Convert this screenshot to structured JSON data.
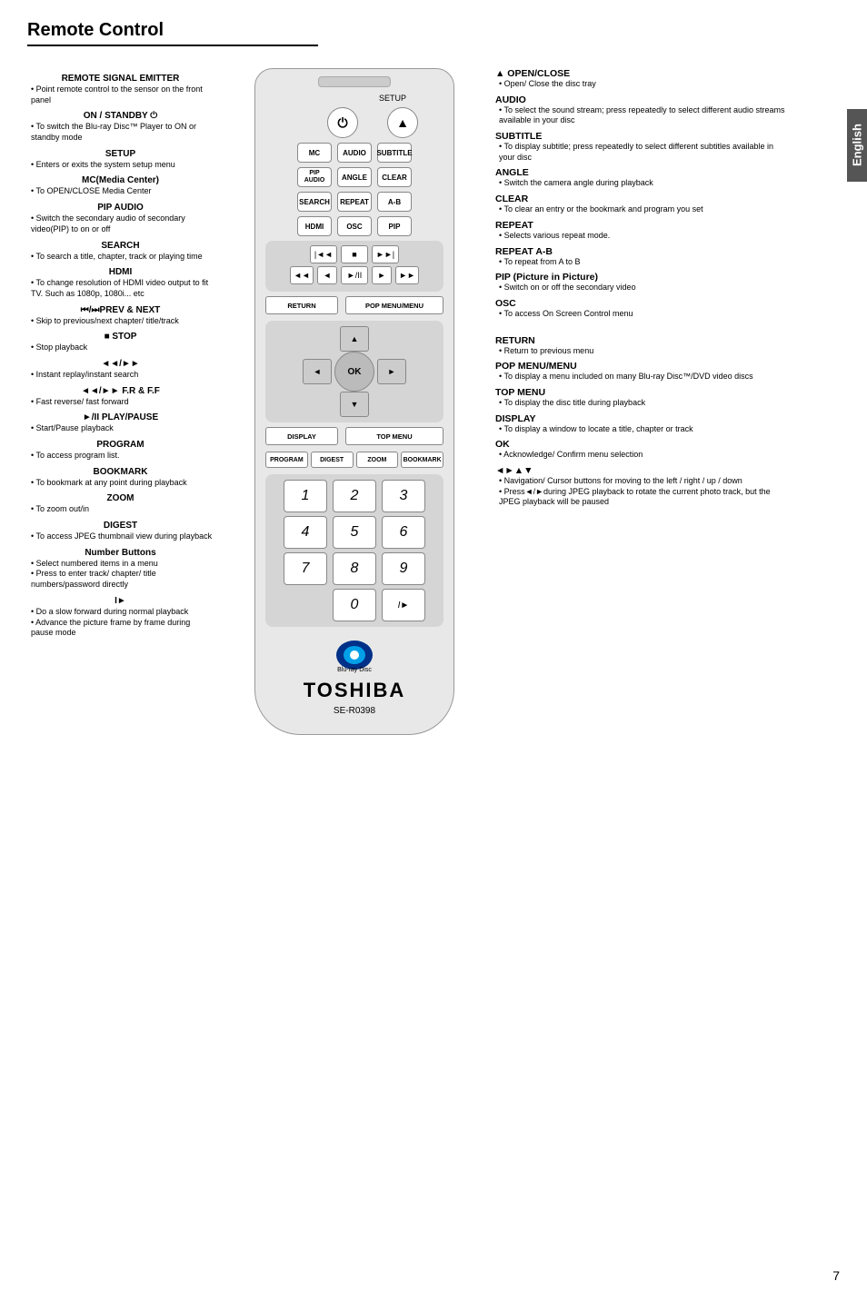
{
  "page": {
    "title": "Remote Control",
    "page_number": "7",
    "language_tab": "English"
  },
  "left_column": {
    "sections": [
      {
        "id": "remote-signal",
        "title": "REMOTE SIGNAL EMITTER",
        "bullets": [
          "Point remote control to the sensor on the front panel"
        ]
      },
      {
        "id": "on-standby",
        "title": "ON / STANDBY ⏻",
        "bullets": [
          "To switch the Blu-ray Disc™ Player to ON or standby mode"
        ]
      },
      {
        "id": "setup",
        "title": "SETUP",
        "bullets": [
          "Enters or exits the system setup menu"
        ]
      },
      {
        "id": "mc",
        "title": "MC(Media Center)",
        "bullets": [
          "To OPEN/CLOSE Media Center"
        ]
      },
      {
        "id": "pip-audio",
        "title": "PIP AUDIO",
        "bullets": [
          "Switch the secondary audio of secondary video(PIP) to on or off"
        ]
      },
      {
        "id": "search",
        "title": "SEARCH",
        "bullets": [
          "To search a title, chapter, track or playing time"
        ]
      },
      {
        "id": "hdmi",
        "title": "HDMI",
        "bullets": [
          "To change resolution of HDMI video output to fit TV. Such as 1080p, 1080i... etc"
        ]
      },
      {
        "id": "prev-next",
        "title": "⏮/⏭PREV & NEXT",
        "bullets": [
          "Skip to previous/next chapter/ title/track"
        ]
      },
      {
        "id": "stop",
        "title": "■ STOP",
        "bullets": [
          "Stop playback"
        ]
      },
      {
        "id": "instant",
        "title": "◄◄/►► ",
        "bullets": [
          "Instant replay/instant search"
        ]
      },
      {
        "id": "frf",
        "title": "◄◄/►► F.R & F.F",
        "bullets": [
          "Fast reverse/ fast forward"
        ]
      },
      {
        "id": "playpause",
        "title": "►/II PLAY/PAUSE",
        "bullets": [
          "Start/Pause playback"
        ]
      },
      {
        "id": "program",
        "title": "PROGRAM",
        "bullets": [
          "To access program list."
        ]
      },
      {
        "id": "bookmark",
        "title": "BOOKMARK",
        "bullets": [
          "To bookmark at any point during playback"
        ]
      },
      {
        "id": "zoom",
        "title": "ZOOM",
        "bullets": [
          "To zoom out/in"
        ]
      },
      {
        "id": "digest",
        "title": "DIGEST",
        "bullets": [
          "To access JPEG thumbnail view during playback"
        ]
      },
      {
        "id": "number",
        "title": "Number Buttons",
        "bullets": [
          "Select numbered items in a menu",
          "Press to enter track/ chapter/ title numbers/password directly"
        ]
      },
      {
        "id": "slowfwd",
        "title": "I►",
        "bullets": [
          "Do a slow forward during normal playback",
          "Advance the picture frame by frame during pause mode"
        ]
      }
    ]
  },
  "remote": {
    "setup_label": "SETUP",
    "buttons_row1": [
      {
        "id": "mc",
        "label": "MC"
      },
      {
        "id": "audio",
        "label": "AUDIO"
      },
      {
        "id": "subtitle",
        "label": "SUBTITLE"
      }
    ],
    "buttons_row2": [
      {
        "id": "pip-audio",
        "label": "PIP\nAUDIO"
      },
      {
        "id": "angle",
        "label": "ANGLE"
      },
      {
        "id": "clear",
        "label": "CLEAR"
      }
    ],
    "buttons_row3": [
      {
        "id": "search",
        "label": "SEARCH"
      },
      {
        "id": "repeat",
        "label": "REPEAT"
      },
      {
        "id": "ab",
        "label": "A-B"
      }
    ],
    "buttons_row4": [
      {
        "id": "hdmi",
        "label": "HDMI"
      },
      {
        "id": "osc",
        "label": "OSC"
      },
      {
        "id": "pip",
        "label": "PIP"
      }
    ],
    "transport1": [
      "⏮⏮",
      "■",
      "⏭⏭"
    ],
    "transport2": [
      "◄◄",
      "◄",
      "►/II",
      "►",
      "►►"
    ],
    "return_label": "RETURN",
    "popmenu_label": "POP MENU/MENU",
    "display_label": "DISPLAY",
    "topmenu_label": "TOP MENU",
    "func_buttons": [
      "PROGRAM",
      "DIGEST",
      "ZOOM",
      "BOOKMARK"
    ],
    "numpad": [
      [
        "1",
        "2",
        "3"
      ],
      [
        "4",
        "5",
        "6"
      ],
      [
        "7",
        "8",
        "9"
      ],
      [
        "",
        "0",
        "I►"
      ]
    ],
    "brand": "TOSHIBA",
    "model": "SE-R0398"
  },
  "right_column": {
    "sections": [
      {
        "id": "open-close",
        "title": "▲ OPEN/CLOSE",
        "bullets": [
          "Open/ Close the disc tray"
        ]
      },
      {
        "id": "audio",
        "title": "AUDIO",
        "bullets": [
          "To select the sound stream; press repeatedly to select different audio streams available in your disc"
        ]
      },
      {
        "id": "subtitle",
        "title": "SUBTITLE",
        "bullets": [
          "To display subtitle; press repeatedly to select different subtitles available in your disc"
        ]
      },
      {
        "id": "angle",
        "title": "ANGLE",
        "bullets": [
          "Switch the camera angle during playback"
        ]
      },
      {
        "id": "clear",
        "title": "CLEAR",
        "bullets": [
          "To clear an entry or the bookmark and program you set"
        ]
      },
      {
        "id": "repeat",
        "title": "REPEAT",
        "bullets": [
          "Selects various repeat mode."
        ]
      },
      {
        "id": "repeat-ab",
        "title": "REPEAT A-B",
        "bullets": [
          "To repeat from A to B"
        ]
      },
      {
        "id": "pip",
        "title": "PIP (Picture in Picture)",
        "bullets": [
          "Switch on or off the secondary video"
        ]
      },
      {
        "id": "osc",
        "title": "OSC",
        "bullets": [
          "To access On Screen Control menu"
        ]
      },
      {
        "id": "return",
        "title": "RETURN",
        "bullets": [
          "Return to previous menu"
        ]
      },
      {
        "id": "pop-menu",
        "title": "POP MENU/MENU",
        "bullets": [
          "To display a menu included on many Blu-ray Disc™/DVD video discs"
        ]
      },
      {
        "id": "top-menu",
        "title": "TOP MENU",
        "bullets": [
          "To display the disc title during playback"
        ]
      },
      {
        "id": "display",
        "title": "DISPLAY",
        "bullets": [
          "To display a window to locate a title, chapter or track"
        ]
      },
      {
        "id": "ok",
        "title": "OK",
        "bullets": [
          "Acknowledge/ Confirm menu selection"
        ]
      },
      {
        "id": "nav",
        "title": "◄►▲▼",
        "bullets": [
          "Navigation/ Cursor buttons for moving to the left / right / up / down",
          "Press◄/►during JPEG playback to rotate the current photo track, but the JPEG playback will be paused"
        ]
      }
    ]
  }
}
